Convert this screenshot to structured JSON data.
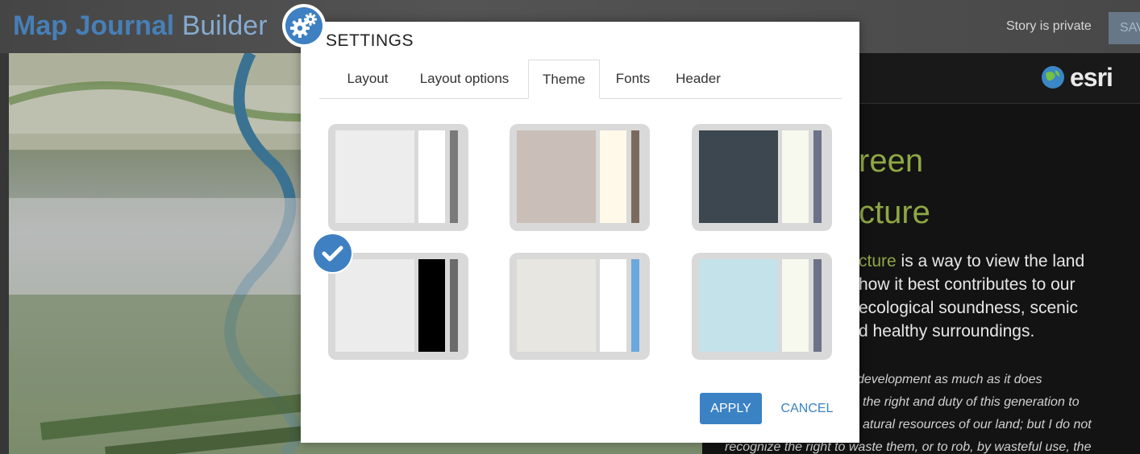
{
  "app": {
    "title_brand": "Map Journal",
    "title_suffix": "Builder",
    "story_status": "Story is private",
    "save_label": "SAV"
  },
  "story": {
    "title_line1": "reen",
    "title_line2": "cture",
    "lead_highlight": "cture",
    "lead_rest1": " is a way to view the land",
    "lead_line2": "how it best contributes to our",
    "lead_line3": "ecological soundness, scenic",
    "lead_line4": "d healthy surroundings.",
    "quote_line1": "development as much as it does",
    "quote_line2": "the right and duty of this generation to",
    "quote_line3": "atural resources of our land; but I do not",
    "quote_line4": "recognize the right to waste them, or to rob, by wasteful use, the",
    "logo_text": "esri"
  },
  "dialog": {
    "title": "SETTINGS",
    "tabs": [
      {
        "label": "Layout"
      },
      {
        "label": "Layout options"
      },
      {
        "label": "Theme"
      },
      {
        "label": "Fonts"
      },
      {
        "label": "Header"
      }
    ],
    "active_tab": "Theme",
    "themes": [
      {
        "main": "#ededed",
        "side": "#ffffff",
        "bar": "#7a7a7a",
        "selected": false
      },
      {
        "main": "#c9bfb8",
        "side": "#fff9ea",
        "bar": "#7a6a5e",
        "selected": false
      },
      {
        "main": "#3c474f",
        "side": "#f7f8ee",
        "bar": "#6c7287",
        "selected": false
      },
      {
        "main": "#ececec",
        "side": "#000000",
        "bar": "#6a6a6a",
        "selected": true
      },
      {
        "main": "#e8e6e0",
        "side": "#ffffff",
        "bar": "#6aa7dd",
        "selected": false
      },
      {
        "main": "#c4e2ea",
        "side": "#f7f8ee",
        "bar": "#6c7287",
        "selected": false
      }
    ],
    "apply_label": "APPLY",
    "cancel_label": "CANCEL"
  },
  "icons": {
    "gear": "gear-icon",
    "check": "checkmark-icon",
    "globe": "globe-icon"
  }
}
